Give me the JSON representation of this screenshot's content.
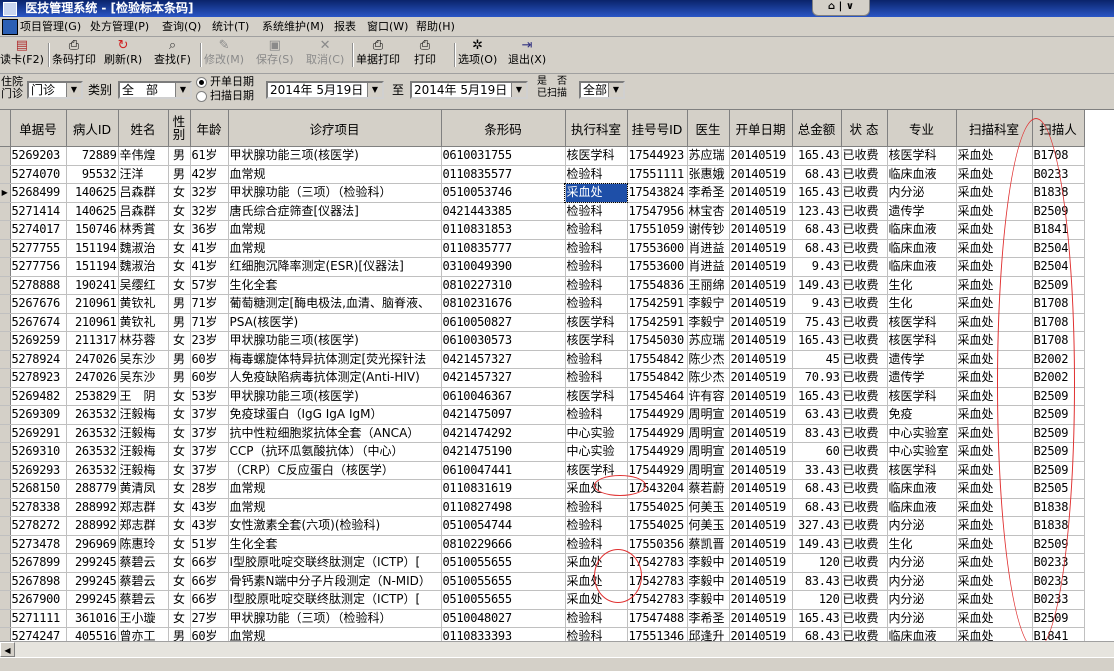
{
  "title": "医技管理系统 - [检验标本条码]",
  "window_buttons": "⌂ | ∨",
  "menu": [
    "项目管理(G)",
    "处方管理(P)",
    "查询(Q)",
    "统计(T)",
    "系统维护(M)",
    "报表",
    "窗口(W)",
    "帮助(H)"
  ],
  "toolbar": [
    {
      "label": "读卡(F2)",
      "icon": "card-reader-icon",
      "enabled": true
    },
    {
      "label": "条码打印",
      "icon": "printer-icon",
      "enabled": true
    },
    {
      "label": "刷新(R)",
      "icon": "refresh-icon",
      "enabled": true
    },
    {
      "label": "查找(F)",
      "icon": "magnifier-icon",
      "enabled": true
    },
    {
      "label": "修改(M)",
      "icon": "edit-icon",
      "enabled": false
    },
    {
      "label": "保存(S)",
      "icon": "save-icon",
      "enabled": false
    },
    {
      "label": "取消(C)",
      "icon": "cancel-icon",
      "enabled": false
    },
    {
      "label": "单据打印",
      "icon": "printer-icon",
      "enabled": true
    },
    {
      "label": "打印",
      "icon": "printer-icon",
      "enabled": true
    },
    {
      "label": "选项(O)",
      "icon": "gear-icon",
      "enabled": true
    },
    {
      "label": "退出(X)",
      "icon": "exit-icon",
      "enabled": true
    }
  ],
  "filters": {
    "dept_label_1": "住院",
    "dept_label_2": "门诊",
    "dept_value": "门诊",
    "category_label": "类别",
    "category_value": "全　部",
    "radio_open_date": "开单日期",
    "radio_scan_date": "扫描日期",
    "date_from": "2014年 5月19日",
    "to_label": "至",
    "date_to": "2014年 5月19日",
    "scanned_label_1": "是　否",
    "scanned_label_2": "已扫描",
    "scanned_value": "全部"
  },
  "columns": [
    "单据号",
    "病人ID",
    "姓名",
    "性别",
    "年龄",
    "诊疗项目",
    "条形码",
    "执行科室",
    "挂号号ID",
    "医生",
    "开单日期",
    "总金额",
    "状 态",
    "专业",
    "扫描科室",
    "扫描人"
  ],
  "rows": [
    [
      "5269203",
      "72889",
      "辛伟煌",
      "男",
      "61岁",
      "甲状腺功能三项(核医学)",
      "0610031755",
      "核医学科",
      "17544923",
      "苏应瑞",
      "20140519",
      "165.43",
      "已收费",
      "核医学科",
      "采血处",
      "B1708"
    ],
    [
      "5274070",
      "95532",
      "汪洋",
      "男",
      "42岁",
      "血常规",
      "0110835577",
      "检验科",
      "17551111",
      "张惠娥",
      "20140519",
      "68.43",
      "已收费",
      "临床血液",
      "采血处",
      "B0233"
    ],
    [
      "5268499",
      "140625",
      "吕森群",
      "女",
      "32岁",
      "甲状腺功能（三项）（检验科）",
      "0510053746",
      "采血处",
      "17543824",
      "李希圣",
      "20140519",
      "165.43",
      "已收费",
      "内分泌",
      "采血处",
      "B1838"
    ],
    [
      "5271414",
      "140625",
      "吕森群",
      "女",
      "32岁",
      "唐氏综合症筛查[仪器法]",
      "0421443385",
      "检验科",
      "17547956",
      "林宝杏",
      "20140519",
      "123.43",
      "已收费",
      "遗传学",
      "采血处",
      "B2509"
    ],
    [
      "5274017",
      "150746",
      "林秀賞",
      "女",
      "36岁",
      "血常规",
      "0110831853",
      "检验科",
      "17551059",
      "谢传钞",
      "20140519",
      "68.43",
      "已收费",
      "临床血液",
      "采血处",
      "B1841"
    ],
    [
      "5277755",
      "151194",
      "魏淑治",
      "女",
      "41岁",
      "血常规",
      "0110835777",
      "检验科",
      "17553600",
      "肖进益",
      "20140519",
      "68.43",
      "已收费",
      "临床血液",
      "采血处",
      "B2504"
    ],
    [
      "5277756",
      "151194",
      "魏淑治",
      "女",
      "41岁",
      "红细胞沉降率测定(ESR)[仪器法]",
      "0310049390",
      "检验科",
      "17553600",
      "肖进益",
      "20140519",
      "9.43",
      "已收费",
      "临床血液",
      "采血处",
      "B2504"
    ],
    [
      "5278888",
      "190241",
      "吴缨红",
      "女",
      "57岁",
      "生化全套",
      "0810227310",
      "检验科",
      "17554836",
      "王丽绵",
      "20140519",
      "149.43",
      "已收费",
      "生化",
      "采血处",
      "B2509"
    ],
    [
      "5267676",
      "210961",
      "黄钦礼",
      "男",
      "71岁",
      "葡萄糖测定[酶电极法,血清、脑脊液、",
      "0810231676",
      "检验科",
      "17542591",
      "李毅宁",
      "20140519",
      "9.43",
      "已收费",
      "生化",
      "采血处",
      "B1708"
    ],
    [
      "5267674",
      "210961",
      "黄钦礼",
      "男",
      "71岁",
      "PSA(核医学)",
      "0610050827",
      "核医学科",
      "17542591",
      "李毅宁",
      "20140519",
      "75.43",
      "已收费",
      "核医学科",
      "采血处",
      "B1708"
    ],
    [
      "5269259",
      "211317",
      "林芬蓉",
      "女",
      "23岁",
      "甲状腺功能三项(核医学)",
      "0610030573",
      "核医学科",
      "17545030",
      "苏应瑞",
      "20140519",
      "165.43",
      "已收费",
      "核医学科",
      "采血处",
      "B1708"
    ],
    [
      "5278924",
      "247026",
      "吴东沙",
      "男",
      "60岁",
      "梅毒螺旋体特异抗体测定[荧光探针法",
      "0421457327",
      "检验科",
      "17554842",
      "陈少杰",
      "20140519",
      "45",
      "已收费",
      "遗传学",
      "采血处",
      "B2002"
    ],
    [
      "5278923",
      "247026",
      "吴东沙",
      "男",
      "60岁",
      "人免疫缺陷病毒抗体测定(Anti-HIV)",
      "0421457327",
      "检验科",
      "17554842",
      "陈少杰",
      "20140519",
      "70.93",
      "已收费",
      "遗传学",
      "采血处",
      "B2002"
    ],
    [
      "5269482",
      "253829",
      "王　阴",
      "女",
      "53岁",
      "甲状腺功能三项(核医学)",
      "0610046367",
      "核医学科",
      "17545464",
      "许有容",
      "20140519",
      "165.43",
      "已收费",
      "核医学科",
      "采血处",
      "B2509"
    ],
    [
      "5269309",
      "263532",
      "汪毅梅",
      "女",
      "37岁",
      "免疫球蛋白（IgG IgA IgM）",
      "0421475097",
      "检验科",
      "17544929",
      "周明宣",
      "20140519",
      "63.43",
      "已收费",
      "免疫",
      "采血处",
      "B2509"
    ],
    [
      "5269291",
      "263532",
      "汪毅梅",
      "女",
      "37岁",
      "抗中性粒细胞浆抗体全套（ANCA）",
      "0421474292",
      "中心实验",
      "17544929",
      "周明宣",
      "20140519",
      "83.43",
      "已收费",
      "中心实验室",
      "采血处",
      "B2509"
    ],
    [
      "5269310",
      "263532",
      "汪毅梅",
      "女",
      "37岁",
      "CCP（抗环瓜氨酸抗体）（中心）",
      "0421475190",
      "中心实验",
      "17544929",
      "周明宣",
      "20140519",
      "60",
      "已收费",
      "中心实验室",
      "采血处",
      "B2509"
    ],
    [
      "5269293",
      "263532",
      "汪毅梅",
      "女",
      "37岁",
      "（CRP）C反应蛋白（核医学）",
      "0610047441",
      "核医学科",
      "17544929",
      "周明宣",
      "20140519",
      "33.43",
      "已收费",
      "核医学科",
      "采血处",
      "B2509"
    ],
    [
      "5268150",
      "288779",
      "黄清凤",
      "女",
      "28岁",
      "血常规",
      "0110831619",
      "采血处",
      "17543204",
      "蔡若蔚",
      "20140519",
      "68.43",
      "已收费",
      "临床血液",
      "采血处",
      "B2505"
    ],
    [
      "5278338",
      "288992",
      "郑志群",
      "女",
      "43岁",
      "血常规",
      "0110827498",
      "检验科",
      "17554025",
      "何美玉",
      "20140519",
      "68.43",
      "已收费",
      "临床血液",
      "采血处",
      "B1838"
    ],
    [
      "5278272",
      "288992",
      "郑志群",
      "女",
      "43岁",
      "女性激素全套(六项)(检验科)",
      "0510054744",
      "检验科",
      "17554025",
      "何美玉",
      "20140519",
      "327.43",
      "已收费",
      "内分泌",
      "采血处",
      "B1838"
    ],
    [
      "5273478",
      "296969",
      "陈惠玲",
      "女",
      "51岁",
      "生化全套",
      "0810229666",
      "检验科",
      "17550356",
      "蔡凯晋",
      "20140519",
      "149.43",
      "已收费",
      "生化",
      "采血处",
      "B2509"
    ],
    [
      "5267899",
      "299245",
      "蔡碧云",
      "女",
      "66岁",
      "I型胶原吡啶交联终肽测定（ICTP）[",
      "0510055655",
      "采血处",
      "17542783",
      "李毅中",
      "20140519",
      "120",
      "已收费",
      "内分泌",
      "采血处",
      "B0233"
    ],
    [
      "5267898",
      "299245",
      "蔡碧云",
      "女",
      "66岁",
      "骨钙素N端中分子片段测定（N-MID）",
      "0510055655",
      "采血处",
      "17542783",
      "李毅中",
      "20140519",
      "83.43",
      "已收费",
      "内分泌",
      "采血处",
      "B0233"
    ],
    [
      "5267900",
      "299245",
      "蔡碧云",
      "女",
      "66岁",
      "I型胶原吡啶交联终肽测定（ICTP）[",
      "0510055655",
      "采血处",
      "17542783",
      "李毅中",
      "20140519",
      "120",
      "已收费",
      "内分泌",
      "采血处",
      "B0233"
    ],
    [
      "5271111",
      "361016",
      "王小璇",
      "女",
      "27岁",
      "甲状腺功能（三项）（检验科）",
      "0510048027",
      "检验科",
      "17547488",
      "李希圣",
      "20140519",
      "165.43",
      "已收费",
      "内分泌",
      "采血处",
      "B2509"
    ],
    [
      "5274247",
      "405516",
      "曾亦工",
      "男",
      "60岁",
      "血常规",
      "0110833393",
      "检验科",
      "17551346",
      "邱逢升",
      "20140519",
      "68.43",
      "已收费",
      "临床血液",
      "采血处",
      "B1841"
    ]
  ],
  "current_row_marker": "▶"
}
